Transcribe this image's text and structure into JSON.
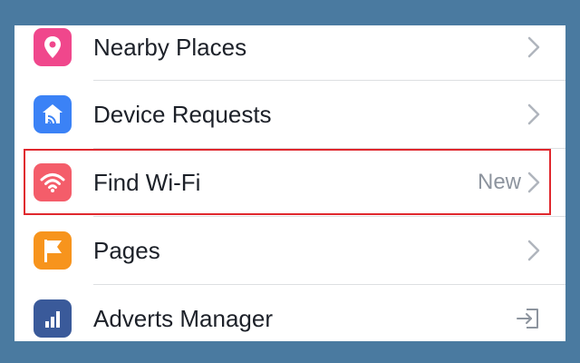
{
  "colors": {
    "page_background": "#4a7aa0",
    "nearby_icon": "#f0478c",
    "device_icon": "#3b82f6",
    "wifi_icon": "#f45d6a",
    "pages_icon": "#f7941d",
    "adverts_icon": "#3a5a9a",
    "highlight_border": "#e0282e"
  },
  "menu": {
    "items": [
      {
        "label": "Nearby Places",
        "icon": "map-pin-icon",
        "trailing": "chevron-right-icon"
      },
      {
        "label": "Device Requests",
        "icon": "device-request-icon",
        "trailing": "chevron-right-icon"
      },
      {
        "label": "Find Wi-Fi",
        "icon": "wifi-icon",
        "badge": "New",
        "trailing": "chevron-right-icon",
        "highlighted": true
      },
      {
        "label": "Pages",
        "icon": "flag-icon",
        "trailing": "chevron-right-icon"
      },
      {
        "label": "Adverts Manager",
        "icon": "bar-chart-icon",
        "trailing": "open-external-icon"
      }
    ]
  }
}
